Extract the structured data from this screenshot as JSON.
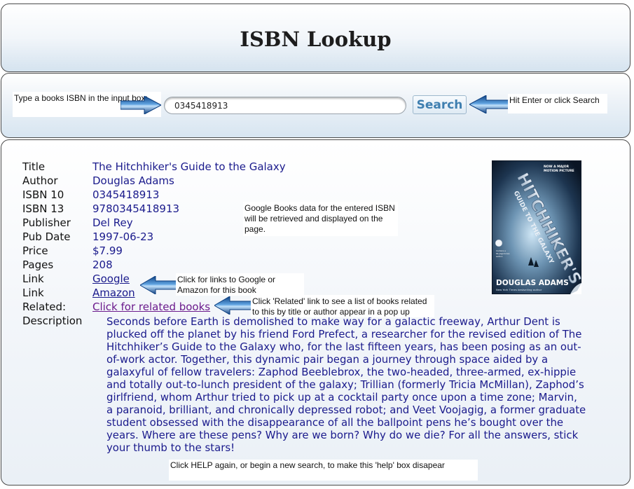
{
  "header": {
    "title": "ISBN Lookup"
  },
  "search": {
    "hint_left": "Type a books ISBN in the input box:",
    "isbn_value": "0345418913",
    "button_label": "Search",
    "hint_right": "Hit Enter or click Search"
  },
  "book": {
    "labels": {
      "title": "Title",
      "author": "Author",
      "isbn10": "ISBN 10",
      "isbn13": "ISBN 13",
      "publisher": "Publisher",
      "pub_date": "Pub Date",
      "price": "Price",
      "pages": "Pages",
      "link1": "Link",
      "link2": "Link",
      "related": "Related:",
      "description": "Description"
    },
    "title": "The Hitchhiker's Guide to the Galaxy",
    "author": "Douglas Adams",
    "isbn10": "0345418913",
    "isbn13": "9780345418913",
    "publisher": "Del Rey",
    "pub_date": "1997-06-23",
    "price": "$7.99",
    "pages": "208",
    "link_google": "Google",
    "link_amazon": "Amazon",
    "related_link": "Click for related books",
    "description": "Seconds before Earth is demolished to make way for a galactic freeway, Arthur Dent is plucked off the planet by his friend Ford Prefect, a researcher for the revised edition of The Hitchhiker’s Guide to the Galaxy who, for the last fifteen years, has been posing as an out-of-work actor. Together, this dynamic pair began a journey through space aided by a galaxyful of fellow travelers: Zaphod Beeblebrox, the two-headed, three-armed, ex-hippie and totally out-to-lunch president of the galaxy; Trillian (formerly Tricia McMillan), Zaphod’s girlfriend, whom Arthur tried to pick up at a cocktail party once upon a time zone; Marvin, a paranoid, brilliant, and chronically depressed robot; and Veet Voojagig, a former graduate student obsessed with the disappearance of all the ballpoint pens he’s bought over the years. Where are these pens? Why are we born? Why do we die? For all the answers, stick your thumb to the stars!"
  },
  "cover": {
    "banner": "NOW A MAJOR MOTION PICTURE",
    "title_art": "HITCHHIKER'S GUIDE TO THE GALAXY",
    "blurb": "Contains a 64-page bonus section featuring an interview with the creator of the Guide",
    "author": "DOUGLAS ADAMS",
    "tagline": "New York Times bestselling author"
  },
  "help_notes": {
    "google_books": "Google Books data for the entered ISBN will be retrieved and displayed on the page.",
    "links": "Click for links to Google or Amazon for this book",
    "related": "Click 'Related' link to see a list of books related to this by title or author appear in a pop up",
    "close_help": "Click HELP again, or begin a new search, to make this 'help' box disapear"
  },
  "colors": {
    "value_text": "#1a1a8c",
    "visited_link": "#6b1a8c",
    "button_text": "#3f7fb0",
    "arrow_blue": "#1f5fa8"
  }
}
